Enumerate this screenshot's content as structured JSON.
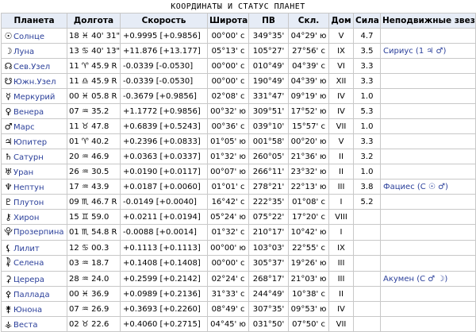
{
  "title": "КООРДИНАТЫ И СТАТУС ПЛАНЕТ",
  "headers": [
    "Планета",
    "Долгота",
    "Скорость",
    "Широта",
    "ПВ",
    "Скл.",
    "Дом",
    "Сила",
    "Неподвижные звезды"
  ],
  "rows": [
    {
      "glyph": "☉",
      "name": "Солнце",
      "deg": "18",
      "sign": "♓",
      "min": "40' 31\"",
      "retro": "",
      "speed": "+0.9995 [+0.9856]",
      "lat": "00°00' с",
      "ra": "349°35'",
      "decl": "04°29' ю",
      "house": "V",
      "strength": "4.7",
      "star": ""
    },
    {
      "glyph": "☽",
      "name": "Луна",
      "deg": "13",
      "sign": "♋",
      "min": "40' 13\"",
      "retro": "",
      "speed": "+11.876 [+13.177]",
      "lat": "05°13' с",
      "ra": "105°27'",
      "decl": "27°56' с",
      "house": "IX",
      "strength": "3.5",
      "star": "Сириус (1 ♃ ♂)"
    },
    {
      "glyph": "☊",
      "name": "Сев.Узел",
      "deg": "11",
      "sign": "♈",
      "min": "45.9",
      "retro": "R",
      "speed": "-0.0339 [-0.0530]",
      "lat": "00°00' с",
      "ra": "010°49'",
      "decl": "04°39' с",
      "house": "VI",
      "strength": "3.3",
      "star": ""
    },
    {
      "glyph": "☋",
      "name": "Южн.Узел",
      "deg": "11",
      "sign": "♎",
      "min": "45.9",
      "retro": "R",
      "speed": "-0.0339 [-0.0530]",
      "lat": "00°00' с",
      "ra": "190°49'",
      "decl": "04°39' ю",
      "house": "XII",
      "strength": "3.3",
      "star": ""
    },
    {
      "glyph": "☿",
      "name": "Меркурий",
      "deg": "00",
      "sign": "♓",
      "min": "05.8",
      "retro": "R",
      "speed": "-0.3679 [+0.9856]",
      "lat": "02°08' с",
      "ra": "331°47'",
      "decl": "09°19' ю",
      "house": "IV",
      "strength": "1.0",
      "star": ""
    },
    {
      "glyph": "♀",
      "name": "Венера",
      "deg": "07",
      "sign": "♒",
      "min": "35.2",
      "retro": "",
      "speed": "+1.1772 [+0.9856]",
      "lat": "00°32' ю",
      "ra": "309°51'",
      "decl": "17°52' ю",
      "house": "IV",
      "strength": "5.3",
      "star": ""
    },
    {
      "glyph": "♂",
      "name": "Марс",
      "deg": "11",
      "sign": "♉",
      "min": "47.8",
      "retro": "",
      "speed": "+0.6839 [+0.5243]",
      "lat": "00°36' с",
      "ra": "039°10'",
      "decl": "15°57' с",
      "house": "VII",
      "strength": "1.0",
      "star": ""
    },
    {
      "glyph": "♃",
      "name": "Юпитер",
      "deg": "01",
      "sign": "♈",
      "min": "40.2",
      "retro": "",
      "speed": "+0.2396 [+0.0833]",
      "lat": "01°05' ю",
      "ra": "001°58'",
      "decl": "00°20' ю",
      "house": "V",
      "strength": "3.3",
      "star": ""
    },
    {
      "glyph": "♄",
      "name": "Сатурн",
      "deg": "20",
      "sign": "♒",
      "min": "46.9",
      "retro": "",
      "speed": "+0.0363 [+0.0337]",
      "lat": "01°32' ю",
      "ra": "260°05'",
      "decl": "21°36' ю",
      "house": "II",
      "strength": "3.2",
      "star": ""
    },
    {
      "glyph": "♅",
      "name": "Уран",
      "deg": "26",
      "sign": "♒",
      "min": "30.5",
      "retro": "",
      "speed": "+0.0190 [+0.0117]",
      "lat": "00°07' ю",
      "ra": "266°11'",
      "decl": "23°32' ю",
      "house": "II",
      "strength": "1.0",
      "star": ""
    },
    {
      "glyph": "♆",
      "name": "Нептун",
      "deg": "17",
      "sign": "♒",
      "min": "43.9",
      "retro": "",
      "speed": "+0.0187 [+0.0060]",
      "lat": "01°01' с",
      "ra": "278°21'",
      "decl": "22°13' ю",
      "house": "III",
      "strength": "3.8",
      "star": "Фациес (С ☉ ♂)"
    },
    {
      "glyph": "♇",
      "name": "Плутон",
      "deg": "09",
      "sign": "♏",
      "min": "46.7",
      "retro": "R",
      "speed": "-0.0149 [+0.0040]",
      "lat": "16°42' с",
      "ra": "222°35'",
      "decl": "01°08' с",
      "house": "I",
      "strength": "5.2",
      "star": ""
    },
    {
      "glyph": "⚷",
      "name": "Хирон",
      "deg": "15",
      "sign": "♊",
      "min": "59.0",
      "retro": "",
      "speed": "+0.0211 [+0.0194]",
      "lat": "05°24' ю",
      "ra": "075°22'",
      "decl": "17°20' с",
      "house": "VIII",
      "strength": "",
      "star": ""
    },
    {
      "glyph": "⯓",
      "name": "Прозерпина",
      "deg": "01",
      "sign": "♏",
      "min": "54.8",
      "retro": "R",
      "speed": "-0.0088 [+0.0014]",
      "lat": "01°32' с",
      "ra": "210°17'",
      "decl": "10°42' ю",
      "house": "I",
      "strength": "",
      "star": ""
    },
    {
      "glyph": "⚸",
      "name": "Лилит",
      "deg": "12",
      "sign": "♋",
      "min": "00.3",
      "retro": "",
      "speed": "+0.1113 [+0.1113]",
      "lat": "00°00' ю",
      "ra": "103°03'",
      "decl": "22°55' с",
      "house": "IX",
      "strength": "",
      "star": ""
    },
    {
      "glyph": "⯝",
      "name": "Селена",
      "deg": "03",
      "sign": "♒",
      "min": "18.7",
      "retro": "",
      "speed": "+0.1408 [+0.1408]",
      "lat": "00°00' с",
      "ra": "305°37'",
      "decl": "19°26' ю",
      "house": "III",
      "strength": "",
      "star": ""
    },
    {
      "glyph": "⚳",
      "name": "Церера",
      "deg": "28",
      "sign": "♒",
      "min": "24.0",
      "retro": "",
      "speed": "+0.2599 [+0.2142]",
      "lat": "02°24' с",
      "ra": "268°17'",
      "decl": "21°03' ю",
      "house": "III",
      "strength": "",
      "star": "Акумен (С ♂ ☽)"
    },
    {
      "glyph": "⚴",
      "name": "Паллада",
      "deg": "00",
      "sign": "♓",
      "min": "36.9",
      "retro": "",
      "speed": "+0.0989 [+0.2136]",
      "lat": "31°33' с",
      "ra": "244°49'",
      "decl": "10°38' с",
      "house": "II",
      "strength": "",
      "star": ""
    },
    {
      "glyph": "⚵",
      "name": "Юнона",
      "deg": "07",
      "sign": "♒",
      "min": "26.9",
      "retro": "",
      "speed": "+0.3693 [+0.2260]",
      "lat": "08°49' с",
      "ra": "307°35'",
      "decl": "09°53' ю",
      "house": "IV",
      "strength": "",
      "star": ""
    },
    {
      "glyph": "⚶",
      "name": "Веста",
      "deg": "02",
      "sign": "♉",
      "min": "22.6",
      "retro": "",
      "speed": "+0.4060 [+0.2715]",
      "lat": "04°45' ю",
      "ra": "031°50'",
      "decl": "07°50' с",
      "house": "VII",
      "strength": "",
      "star": ""
    }
  ]
}
